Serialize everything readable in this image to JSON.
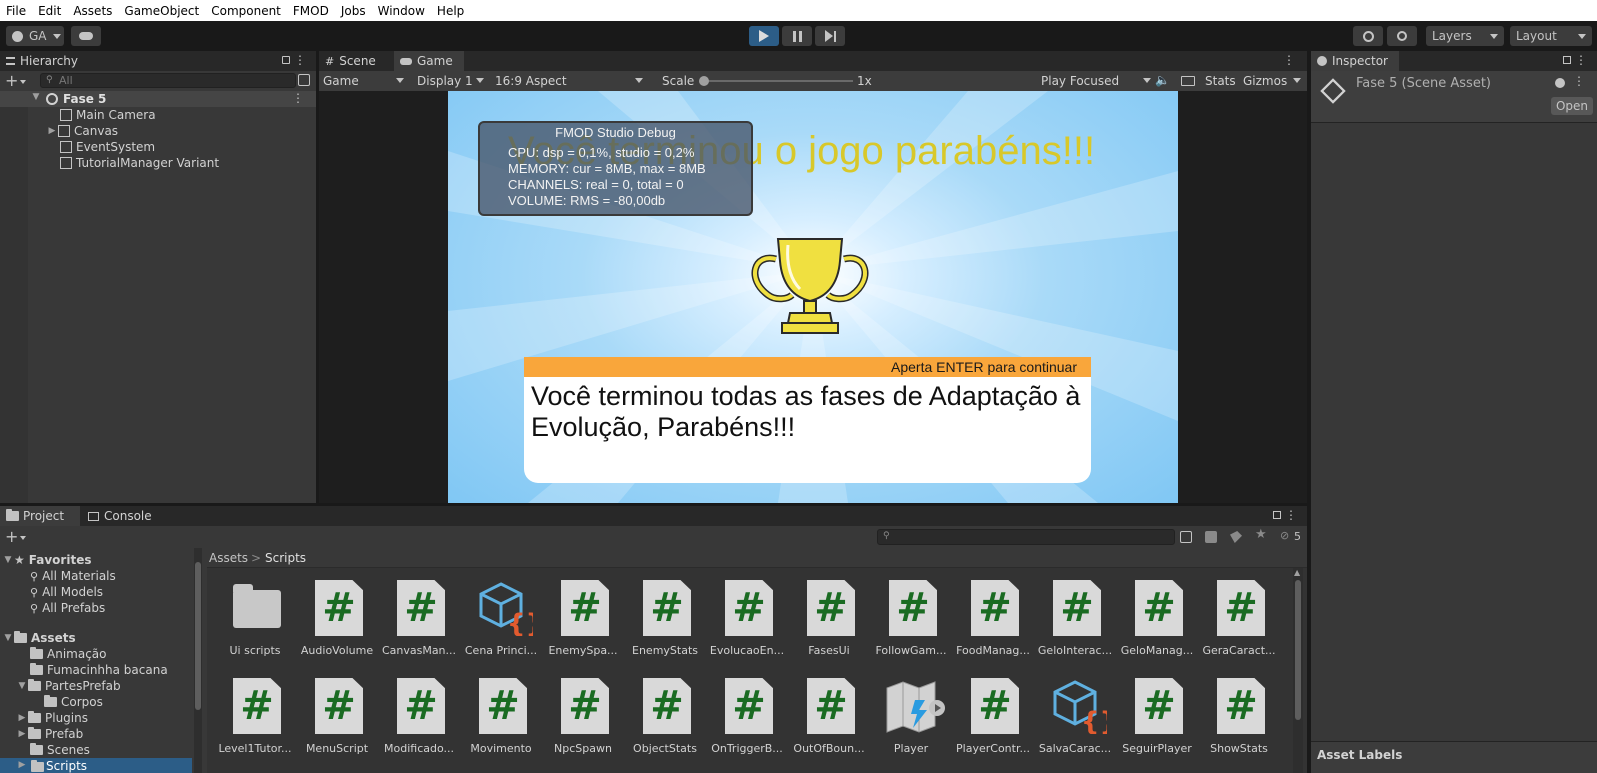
{
  "menu": [
    "File",
    "Edit",
    "Assets",
    "GameObject",
    "Component",
    "FMOD",
    "Jobs",
    "Window",
    "Help"
  ],
  "toolbar": {
    "account": "GA",
    "layers": "Layers",
    "layout": "Layout"
  },
  "hierarchy": {
    "tab": "Hierarchy",
    "search_placeholder": "All",
    "scene": "Fase 5",
    "items": [
      "Main Camera",
      "Canvas",
      "EventSystem",
      "TutorialManager Variant"
    ]
  },
  "view_tabs": {
    "scene": "Scene",
    "game": "Game"
  },
  "game_toolbar": {
    "mode": "Game",
    "display": "Display 1",
    "aspect": "16:9 Aspect",
    "scale_label": "Scale",
    "scale_value": "1x",
    "play_mode": "Play Focused",
    "stats": "Stats",
    "gizmos": "Gizmos"
  },
  "game": {
    "headline": "Você terminou o jogo parabéns!!!",
    "debug_title": "FMOD Studio Debug",
    "debug_lines": [
      "CPU: dsp = 0,1%, studio = 0,2%",
      "MEMORY: cur = 8MB, max = 8MB",
      "CHANNELS: real = 0, total = 0",
      "VOLUME: RMS = -80,00db"
    ],
    "dialog_hint": "Aperta ENTER para continuar",
    "dialog_text": "Você terminou todas as fases de Adaptação à Evolução, Parabéns!!!"
  },
  "inspector": {
    "tab": "Inspector",
    "title": "Fase 5 (Scene Asset)",
    "open": "Open",
    "asset_labels": "Asset Labels"
  },
  "bottom_tabs": {
    "project": "Project",
    "console": "Console"
  },
  "project": {
    "hidden_count": "5",
    "favorites": "Favorites",
    "favorite_items": [
      "All Materials",
      "All Models",
      "All Prefabs"
    ],
    "assets_root": "Assets",
    "asset_tree": [
      "Animação",
      "Fumacinhha bacana",
      "PartesPrefab",
      "Corpos",
      "Plugins",
      "Prefab",
      "Scenes",
      "Scripts"
    ],
    "breadcrumb": [
      "Assets",
      "Scripts"
    ],
    "grid_row1": [
      "Ui scripts",
      "AudioVolume",
      "CanvasMan...",
      "Cena Princi...",
      "EnemySpa...",
      "EnemyStats",
      "EvolucaoEn...",
      "FasesUi",
      "FollowGam...",
      "FoodManag...",
      "GeloInterac...",
      "GeloManag...",
      "GeraCaract..."
    ],
    "grid_row2": [
      "Level1Tutor...",
      "MenuScript",
      "Modificado...",
      "Movimento",
      "NpcSpawn",
      "ObjectStats",
      "OnTriggerB...",
      "OutOfBoun...",
      "Player",
      "PlayerContr...",
      "SalvaCarac...",
      "SeguirPlayer",
      "ShowStats"
    ]
  },
  "colors": {
    "accent": "#2c5d87",
    "bg": "#383838",
    "sky": "#8ccdf5",
    "trophy": "#f0e040",
    "dialog_header": "#f9a63b",
    "script_hash": "#1a6b22"
  }
}
